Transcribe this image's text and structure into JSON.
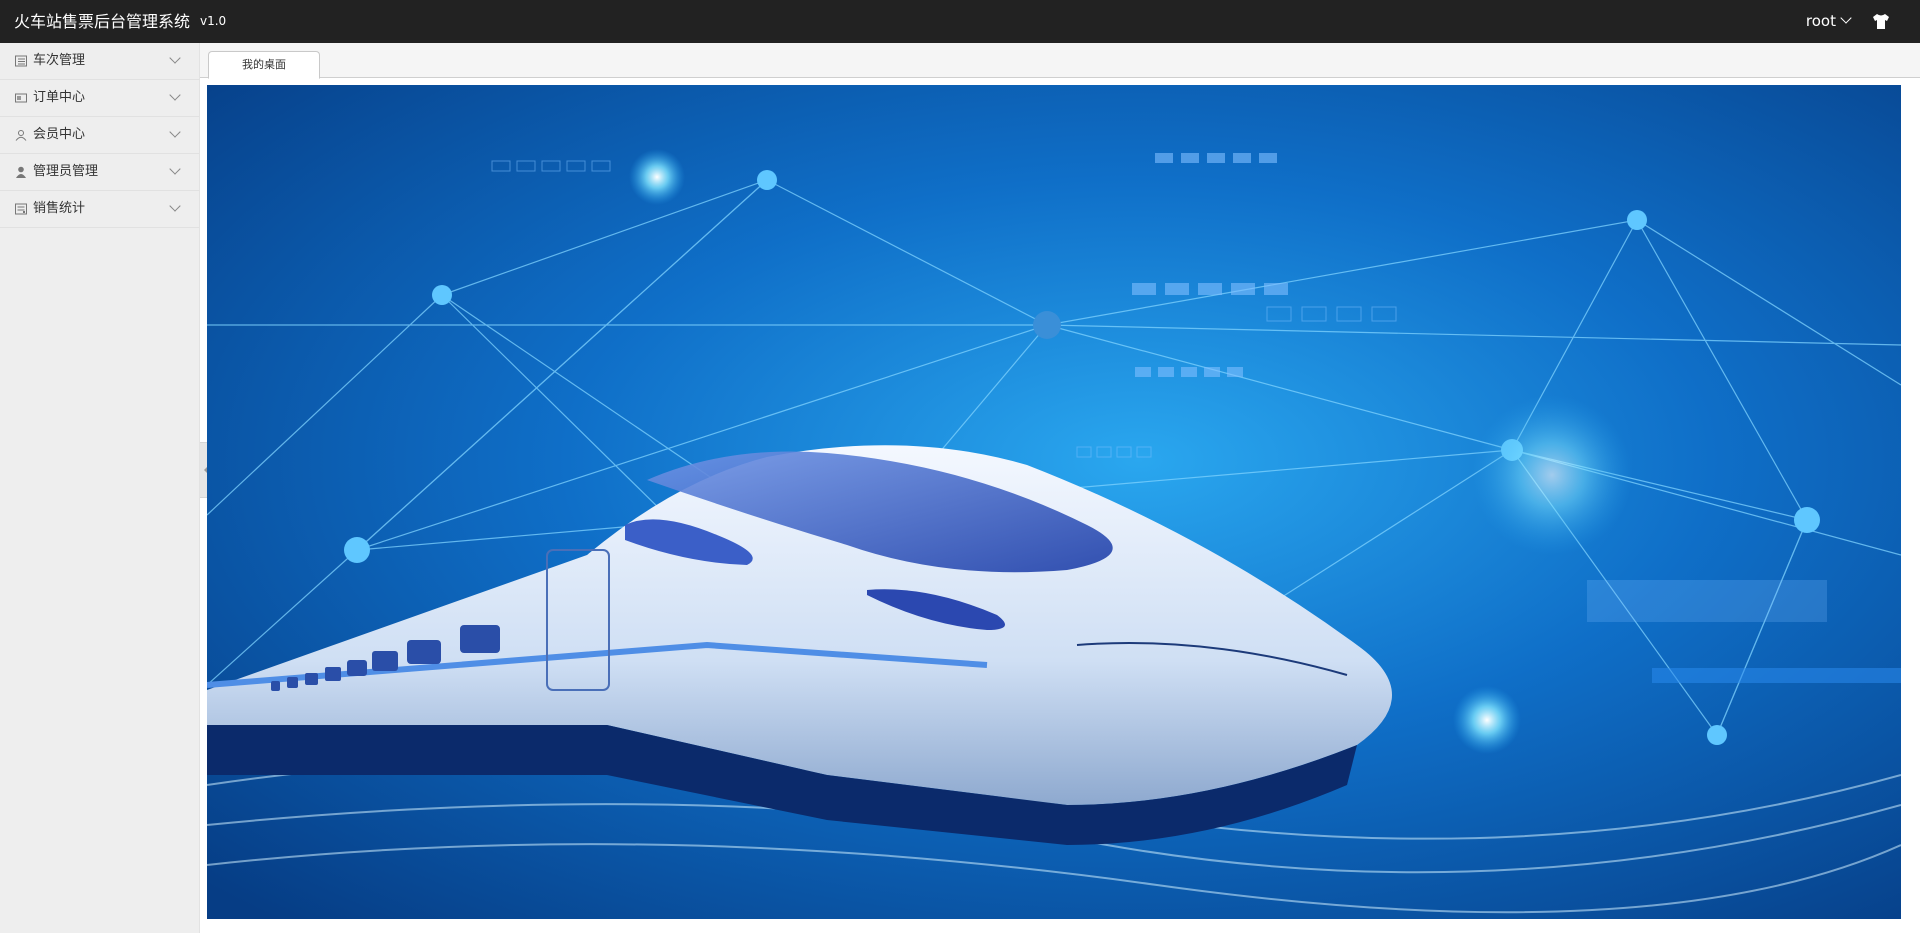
{
  "app": {
    "title": "火车站售票后台管理系统",
    "version": "v1.0"
  },
  "header": {
    "user": "root"
  },
  "sidebar": {
    "items": [
      {
        "label": "车次管理",
        "icon": "list-icon"
      },
      {
        "label": "订单中心",
        "icon": "card-icon"
      },
      {
        "label": "会员中心",
        "icon": "user-outline-icon"
      },
      {
        "label": "管理员管理",
        "icon": "user-solid-icon"
      },
      {
        "label": "销售统计",
        "icon": "stats-icon"
      }
    ]
  },
  "tabs": [
    {
      "label": "我的桌面"
    }
  ],
  "colors": {
    "topbar": "#222222",
    "sidebar": "#eeeeee",
    "hero_bg": "#0b5fb3"
  }
}
